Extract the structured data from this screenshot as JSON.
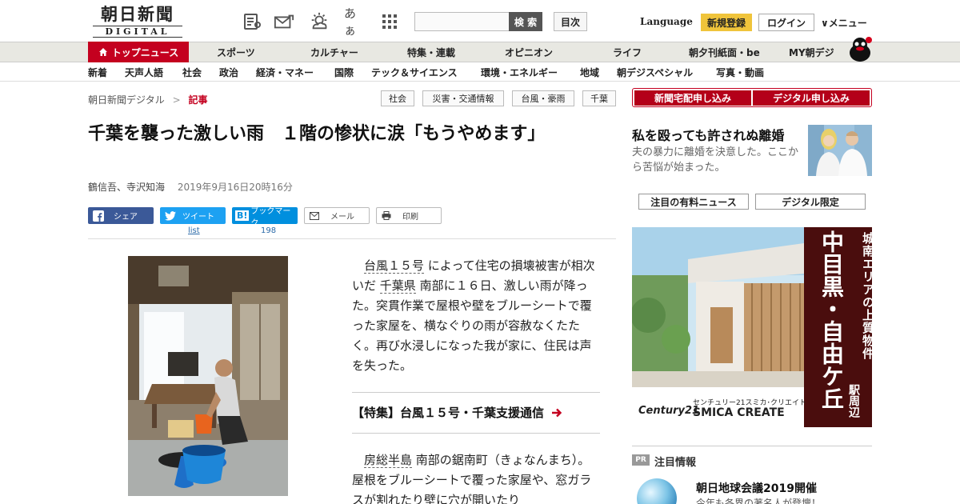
{
  "header": {
    "logo_jp": "朝日新聞",
    "logo_en": "DIGITAL",
    "icons": [
      "newspaper-icon",
      "mail-icon",
      "weather-icon",
      "font-size-icon",
      "grid-icon"
    ],
    "font_size_label": "あぁ",
    "search": {
      "placeholder": "",
      "button": "検 索"
    },
    "toc": "目次",
    "language": "Language",
    "signup": "新規登録",
    "login": "ログイン",
    "menu": "∨メニュー"
  },
  "nav_main": {
    "active": "トップニュース",
    "items": [
      "スポーツ",
      "カルチャー",
      "特集・連載",
      "オピニオン",
      "ライフ",
      "朝夕刊紙面・be",
      "MY朝デジ"
    ]
  },
  "nav_sub": {
    "items": [
      "新着",
      "天声人語",
      "社会",
      "政治",
      "経済・マネー",
      "国際",
      "テック＆サイエンス",
      "環境・エネルギー",
      "地域",
      "朝デジスペシャル",
      "写真・動画"
    ]
  },
  "breadcrumb": {
    "home": "朝日新聞デジタル",
    "sep": ">",
    "current": "記事"
  },
  "tags": [
    "社会",
    "災害・交通情報",
    "台風・豪雨",
    "千葉"
  ],
  "article": {
    "title": "千葉を襲った激しい雨　１階の惨状に涙「もうやめます」",
    "authors": "鶴信吾、寺沢知海",
    "datetime": "2019年9月16日20時16分",
    "share": {
      "facebook": "シェア",
      "twitter": "ツイート",
      "twitter_count": "list",
      "hatena": "ブックマーク",
      "hatena_count": "198",
      "mail": "メール",
      "print": "印刷"
    },
    "p1": {
      "link1": "台風１５号",
      "t1": "によって住宅の損壊被害が相次いだ",
      "link2": "千葉県",
      "t2": "南部に１６日、激しい雨が降った。突貫作業で屋根や壁をブルーシートで覆った家屋を、横なぐりの雨が容赦なくたたく。再び水浸しになった我が家に、住民は声を失った。"
    },
    "special_link": "【特集】台風１５号・千葉支援通信",
    "p2": {
      "link1": "房総半島",
      "t1": "南部の鋸南町（きょなんまち）。屋根をブルーシートで覆った家屋や、窓ガラスが割れたり壁に穴が開いたり"
    }
  },
  "sidebar": {
    "subscribe_paper": "新聞宅配申し込み",
    "subscribe_digital": "デジタル申し込み",
    "feature_title": "私を殴っても許されぬ離婚",
    "feature_desc": "夫の暴力に離婚を決意した。ここから苦悩が始まった。",
    "tab_paid": "注目の有料ニュース",
    "tab_digital": "デジタル限定",
    "ad": {
      "line1": "城南エリアの上質物件",
      "line2": "中目黒・自由ケ丘",
      "line3": "駅周辺",
      "brand": "Century21",
      "company_jp": "センチュリー21スミカ･クリエイト",
      "company_en": "SMICA CREATE"
    },
    "pr": {
      "badge": "PR",
      "label": "注目情報",
      "title": "朝日地球会議2019開催",
      "desc": "今年も各界の著名人が登壇！"
    }
  }
}
